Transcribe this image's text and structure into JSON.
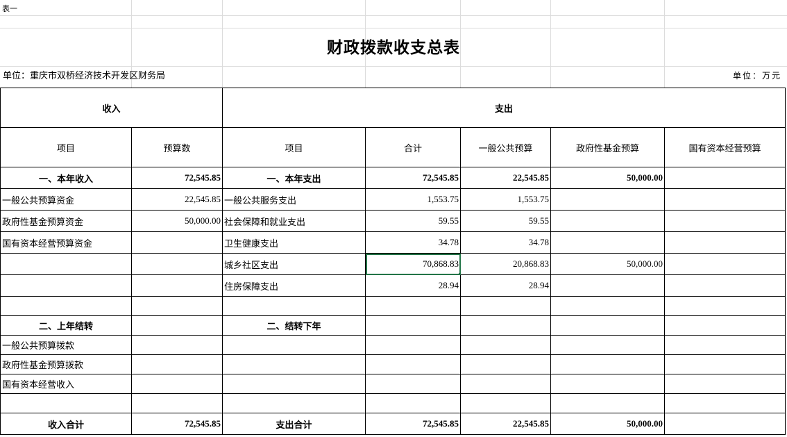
{
  "sheet_label": "表一",
  "title": "财政拨款收支总表",
  "unit_left": "单位：重庆市双桥经济技术开发区财务局",
  "unit_right": "单位：万元",
  "headers": {
    "income": "收入",
    "expense": "支出",
    "col_item": "项目",
    "col_budget": "预算数",
    "col_item2": "项目",
    "col_total": "合计",
    "col_general": "一般公共预算",
    "col_fund": "政府性基金预算",
    "col_state": "国有资本经营预算"
  },
  "rows": [
    {
      "inc_item": "一、本年收入",
      "inc_val": "72,545.85",
      "exp_item": "一、本年支出",
      "total": "72,545.85",
      "general": "22,545.85",
      "fund": "50,000.00",
      "state": ""
    },
    {
      "inc_item": "一般公共预算资金",
      "inc_val": "22,545.85",
      "exp_item": "一般公共服务支出",
      "total": "1,553.75",
      "general": "1,553.75",
      "fund": "",
      "state": ""
    },
    {
      "inc_item": "政府性基金预算资金",
      "inc_val": "50,000.00",
      "exp_item": "社会保障和就业支出",
      "total": "59.55",
      "general": "59.55",
      "fund": "",
      "state": ""
    },
    {
      "inc_item": "国有资本经营预算资金",
      "inc_val": "",
      "exp_item": "卫生健康支出",
      "total": "34.78",
      "general": "34.78",
      "fund": "",
      "state": ""
    },
    {
      "inc_item": "",
      "inc_val": "",
      "exp_item": "城乡社区支出",
      "total": "70,868.83",
      "general": "20,868.83",
      "fund": "50,000.00",
      "state": ""
    },
    {
      "inc_item": "",
      "inc_val": "",
      "exp_item": "住房保障支出",
      "total": "28.94",
      "general": "28.94",
      "fund": "",
      "state": ""
    },
    {
      "inc_item": "",
      "inc_val": "",
      "exp_item": "",
      "total": "",
      "general": "",
      "fund": "",
      "state": ""
    },
    {
      "inc_item": "二、上年结转",
      "inc_val": "",
      "exp_item": "二、结转下年",
      "total": "",
      "general": "",
      "fund": "",
      "state": ""
    },
    {
      "inc_item": "一般公共预算拨款",
      "inc_val": "",
      "exp_item": "",
      "total": "",
      "general": "",
      "fund": "",
      "state": ""
    },
    {
      "inc_item": "政府性基金预算拨款",
      "inc_val": "",
      "exp_item": "",
      "total": "",
      "general": "",
      "fund": "",
      "state": ""
    },
    {
      "inc_item": "国有资本经营收入",
      "inc_val": "",
      "exp_item": "",
      "total": "",
      "general": "",
      "fund": "",
      "state": ""
    },
    {
      "inc_item": "",
      "inc_val": "",
      "exp_item": "",
      "total": "",
      "general": "",
      "fund": "",
      "state": ""
    },
    {
      "inc_item": "收入合计",
      "inc_val": "72,545.85",
      "exp_item": "支出合计",
      "total": "72,545.85",
      "general": "22,545.85",
      "fund": "50,000.00",
      "state": ""
    }
  ],
  "selection_color": "#227447"
}
